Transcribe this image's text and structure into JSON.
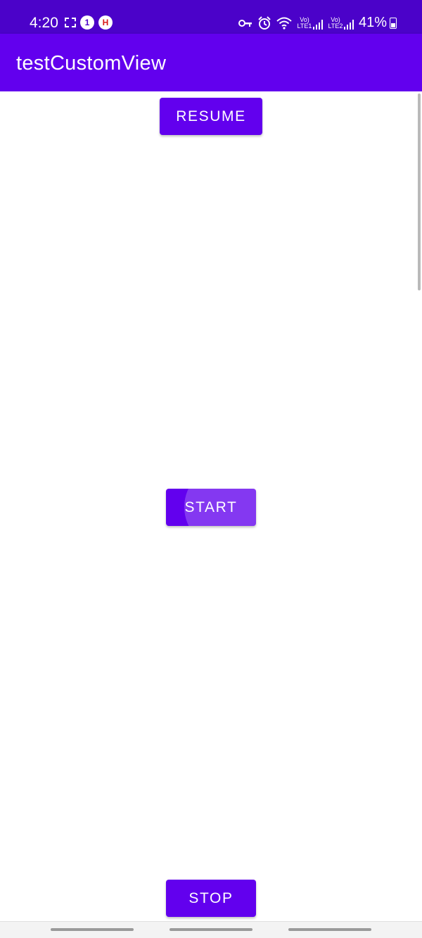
{
  "status_bar": {
    "time": "4:20",
    "notification_badge": "1",
    "shield_badge": "H",
    "battery": "41%",
    "sim1_label": "Vo) LTE1",
    "sim2_label": "Vo) LTE2",
    "icons": [
      "screenshot-icon",
      "one-circle-icon",
      "shield-icon",
      "key-icon",
      "alarm-icon",
      "wifi-icon",
      "signal-icon",
      "signal-icon",
      "battery-icon"
    ]
  },
  "app_bar": {
    "title": "testCustomView",
    "color": "#6200ee"
  },
  "buttons": {
    "resume": "RESUME",
    "start": "START",
    "stop": "STOP"
  },
  "theme": {
    "primary": "#6200ee",
    "status_bar": "#4b02c9"
  }
}
